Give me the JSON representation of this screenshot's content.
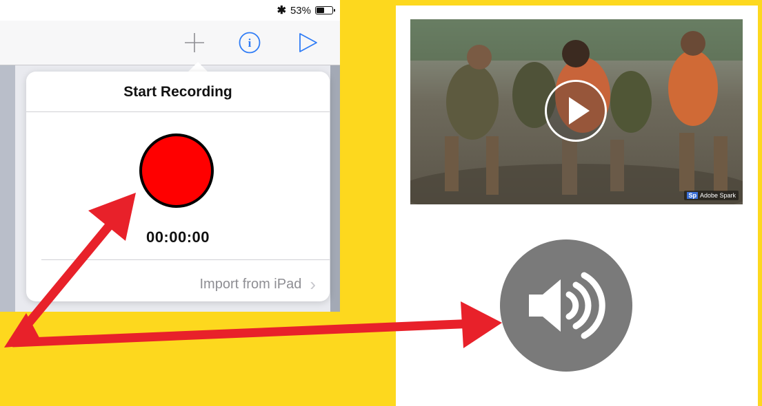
{
  "status_bar": {
    "bluetooth_symbol": "✱",
    "battery_percent_text": "53%",
    "battery_level": 0.53
  },
  "toolbar": {
    "add_icon": "plus-icon",
    "info_icon": "info-icon",
    "play_icon": "play-icon"
  },
  "popover": {
    "title": "Start Recording",
    "timer": "00:00:00",
    "import_label": "Import from iPad",
    "import_chevron": "›"
  },
  "card": {
    "video_icon": "play-icon",
    "watermark_logo": "Sp",
    "watermark_text": "Adobe Spark",
    "speaker_icon": "speaker-icon"
  },
  "colors": {
    "background": "#FDD81E",
    "accent_blue": "#2F7CF6",
    "record_red": "#FF0000",
    "arrow_red": "#E8212A",
    "speaker_gray": "#7A7A7A"
  }
}
